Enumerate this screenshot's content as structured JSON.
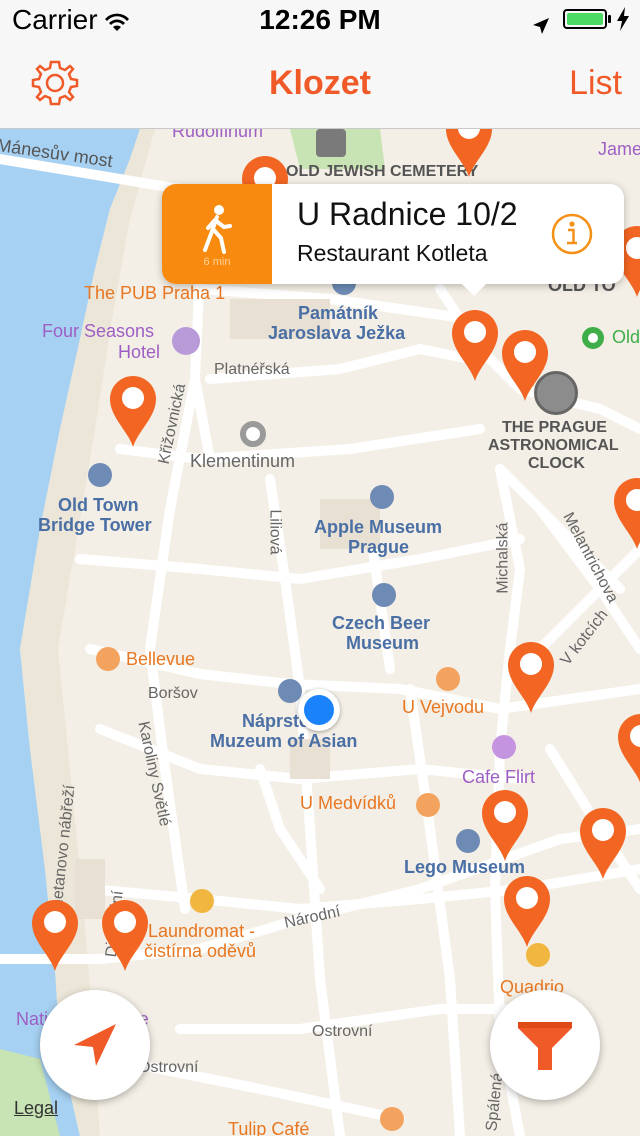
{
  "status_bar": {
    "carrier": "Carrier",
    "time": "12:26 PM",
    "battery_color": "#4cd964"
  },
  "nav": {
    "title": "Klozet",
    "list_label": "List",
    "settings_icon": "gear-icon",
    "accent_color": "#f05a28"
  },
  "callout": {
    "address": "U Radnice 10/2",
    "place_name": "Restaurant Kotleta",
    "walk_time": "6 min",
    "walk_icon": "walking-person-icon",
    "info_icon": "info-icon"
  },
  "map": {
    "labels": {
      "rudolfinum": "Rudolfinum",
      "manesuv_most": "Mánesův most",
      "old_jewish_cemetery": "OLD JEWISH CEMETERY",
      "james": "James",
      "pub_praha": "The PUB Praha 1",
      "pamatnik_1": "Památník",
      "pamatnik_2": "Jaroslava Ježka",
      "four_seasons_1": "Four Seasons",
      "four_seasons_2": "Hotel",
      "platnerska": "Platnéřská",
      "old_town_square": "Old",
      "old_town_top": "OLD TO",
      "krizovnicka": "Křižovnická",
      "prague_clock_1": "THE PRAGUE",
      "prague_clock_2": "ASTRONOMICAL",
      "prague_clock_3": "CLOCK",
      "klementinum": "Klementinum",
      "old_town_bridge_1": "Old Town",
      "old_town_bridge_2": "Bridge Tower",
      "liliova": "Liliová",
      "apple_museum_1": "Apple Museum",
      "apple_museum_2": "Prague",
      "michalska": "Michalská",
      "melantrichova": "Melantrichova",
      "czech_beer_1": "Czech Beer",
      "czech_beer_2": "Museum",
      "v_kotcich": "V kotcích",
      "bellevue": "Bellevue",
      "borsov": "Boršov",
      "u_vejvodu": "U Vejvodu",
      "naprstek_1": "Náprstek",
      "naprstek_2": "Muzeum of Asian",
      "karoliny_svetle": "Karoliny Světlé",
      "cafe_flirt": "Cafe Flirt",
      "u_medvidku": "U Medvídků",
      "smetanovo": "Smetanovo nábřeží",
      "lego_museum": "Lego Museum",
      "laundromat_1": "Laundromat -",
      "laundromat_2": "čistírna oděvů",
      "narodni": "Národní",
      "divadelni": "Divadelní",
      "quadrio": "Quadrio",
      "national_theatre": "National Theatre",
      "ostrovni_1": "Ostrovní",
      "ostrovni_2": "Ostrovní",
      "tulip_cafe": "Tulip Café",
      "spalena": "Spálená"
    },
    "pin_color": "#f26522",
    "user_location_color": "#1a82fb",
    "water_color": "#a6d1f2"
  },
  "controls": {
    "locate_icon": "location-arrow-icon",
    "filter_icon": "filter-funnel-icon",
    "legal_label": "Legal"
  }
}
